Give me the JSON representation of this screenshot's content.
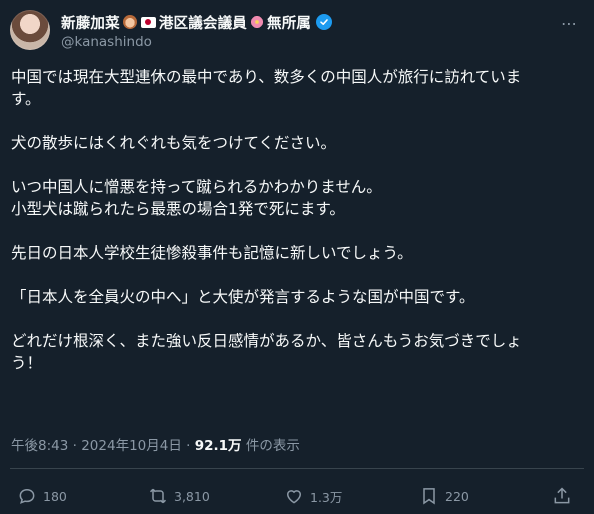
{
  "author": {
    "name_prefix": "新藤加菜",
    "name_party": "港区議会議員",
    "name_suffix": "無所属",
    "handle": "@kanashindo"
  },
  "post": {
    "paragraphs": [
      [
        "中国では現在大型連休の最中であり、数多くの中国人が旅行に訪れていま",
        "す。"
      ],
      [
        "犬の散歩にはくれぐれも気をつけてください。"
      ],
      [
        "いつ中国人に憎悪を持って蹴られるかわかりません。",
        "小型犬は蹴られたら最悪の場合1発で死にます。"
      ],
      [
        "先日の日本人学校生徒惨殺事件も記憶に新しいでしょう。"
      ],
      [
        "「日本人を全員火の中へ」と大使が発言するような国が中国です。"
      ],
      [
        "どれだけ根深く、また強い反日感情があるか、皆さんもうお気づきでしょ",
        "う！"
      ]
    ],
    "time": "午後8:43",
    "date": "2024年10月4日",
    "views": "92.1万",
    "views_label": "件の表示"
  },
  "actions": {
    "replies": "180",
    "reposts": "3,810",
    "likes": "1.3万",
    "bookmarks": "220"
  },
  "icons": {
    "more": "more-dots-icon",
    "reply": "reply-icon",
    "repost": "repost-icon",
    "like": "heart-icon",
    "bookmark": "bookmark-icon",
    "share": "share-icon",
    "verified": "verified-badge-icon"
  },
  "colors": {
    "background": "#15202b",
    "text": "#f7f9f9",
    "muted": "#8b98a5",
    "verified": "#1d9bf0"
  }
}
